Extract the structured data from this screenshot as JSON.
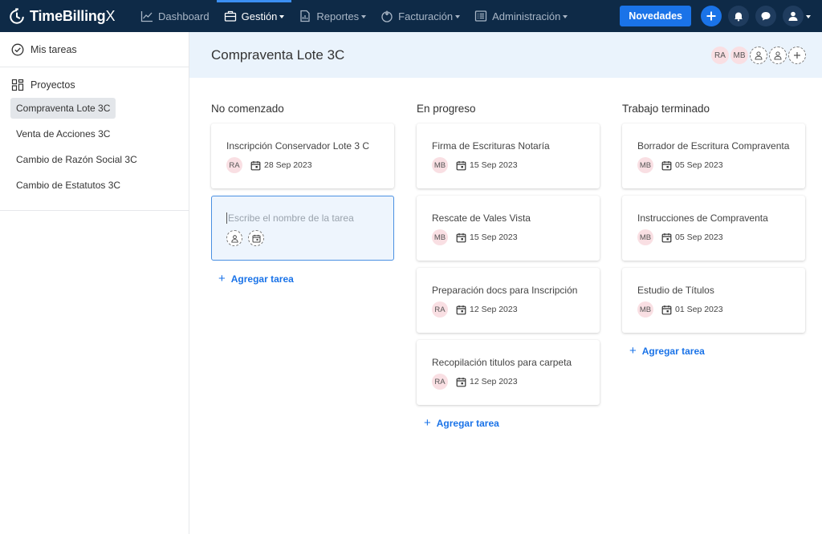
{
  "app": {
    "logo_main": "TimeBilling",
    "logo_x": "X"
  },
  "nav": [
    {
      "label": "Dashboard",
      "icon": "chart-line-icon",
      "active": false
    },
    {
      "label": "Gestión",
      "icon": "briefcase-icon",
      "active": true,
      "caret": true
    },
    {
      "label": "Reportes",
      "icon": "report-icon",
      "active": false,
      "caret": true
    },
    {
      "label": "Facturación",
      "icon": "billing-icon",
      "active": false,
      "caret": true
    },
    {
      "label": "Administración",
      "icon": "admin-list-icon",
      "active": false,
      "caret": true
    }
  ],
  "topright": {
    "news_label": "Novedades"
  },
  "sidebar": {
    "my_tasks": "Mis tareas",
    "projects_label": "Proyectos",
    "projects": [
      {
        "label": "Compraventa Lote 3C",
        "active": true
      },
      {
        "label": "Venta de Acciones 3C",
        "active": false
      },
      {
        "label": "Cambio de Razón Social 3C",
        "active": false
      },
      {
        "label": "Cambio de Estatutos 3C",
        "active": false
      }
    ]
  },
  "header": {
    "title": "Compraventa Lote 3C",
    "members": [
      "RA",
      "MB"
    ]
  },
  "board": {
    "add_task_label": "Agregar tarea",
    "new_task_placeholder": "Escribe el nombre de la tarea",
    "columns": [
      {
        "title": "No comenzado",
        "cards": [
          {
            "title": "Inscripción Conservador Lote 3 C",
            "assignee": "RA",
            "date": "28 Sep 2023"
          }
        ],
        "has_new_card": true
      },
      {
        "title": "En progreso",
        "cards": [
          {
            "title": "Firma de Escrituras Notaría",
            "assignee": "MB",
            "date": "15 Sep 2023"
          },
          {
            "title": "Rescate de Vales Vista",
            "assignee": "MB",
            "date": "15 Sep 2023"
          },
          {
            "title": "Preparación docs para Inscripción",
            "assignee": "RA",
            "date": "12 Sep 2023"
          },
          {
            "title": "Recopilación titulos para carpeta",
            "assignee": "RA",
            "date": "12 Sep 2023"
          }
        ],
        "has_new_card": false
      },
      {
        "title": "Trabajo terminado",
        "cards": [
          {
            "title": "Borrador de Escritura Compraventa",
            "assignee": "MB",
            "date": "05 Sep 2023"
          },
          {
            "title": "Instrucciones de Compraventa",
            "assignee": "MB",
            "date": "05 Sep 2023"
          },
          {
            "title": "Estudio de Títulos",
            "assignee": "MB",
            "date": "01 Sep 2023"
          }
        ],
        "has_new_card": false
      }
    ]
  },
  "colors": {
    "topbar": "#0e2a47",
    "accent": "#1a73e8",
    "header_bg": "#eaf3fc",
    "avatar_pink": "#f9dfe3"
  }
}
